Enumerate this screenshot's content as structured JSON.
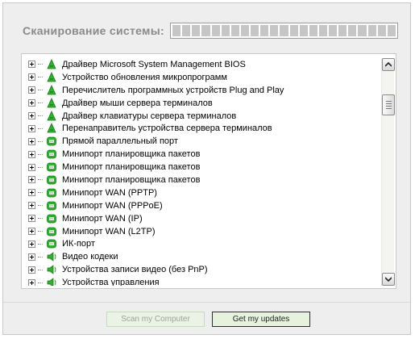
{
  "header": {
    "title": "Сканирование системы:"
  },
  "progress": {
    "segments": 23,
    "filled": 0
  },
  "tree": {
    "rows": [
      {
        "label": "Драйвер Microsoft System Management BIOS",
        "icon": "driver-tree-icon"
      },
      {
        "label": "Устройство обновления микропрограмм",
        "icon": "driver-tree-icon"
      },
      {
        "label": "Перечислитель программных устройств Plug and Play",
        "icon": "driver-tree-icon"
      },
      {
        "label": "Драйвер мыши сервера терминалов",
        "icon": "driver-tree-icon"
      },
      {
        "label": "Драйвер клавиатуры сервера терминалов",
        "icon": "driver-tree-icon"
      },
      {
        "label": "Перенаправитель устройства сервера терминалов",
        "icon": "driver-tree-icon"
      },
      {
        "label": "Прямой параллельный порт",
        "icon": "network-adapter-icon"
      },
      {
        "label": "Минипорт планировщика пакетов",
        "icon": "network-adapter-icon"
      },
      {
        "label": "Минипорт планировщика пакетов",
        "icon": "network-adapter-icon"
      },
      {
        "label": "Минипорт планировщика пакетов",
        "icon": "network-adapter-icon"
      },
      {
        "label": "Минипорт WAN (PPTP)",
        "icon": "network-adapter-icon"
      },
      {
        "label": "Минипорт WAN (PPPoE)",
        "icon": "network-adapter-icon"
      },
      {
        "label": "Минипорт WAN (IP)",
        "icon": "network-adapter-icon"
      },
      {
        "label": "Минипорт WAN (L2TP)",
        "icon": "network-adapter-icon"
      },
      {
        "label": "ИК-порт",
        "icon": "network-adapter-icon"
      },
      {
        "label": "Видео кодеки",
        "icon": "speaker-icon"
      },
      {
        "label": "Устройства записи видео (без PnP)",
        "icon": "speaker-icon"
      },
      {
        "label": "Устройства управления",
        "icon": "speaker-icon"
      }
    ]
  },
  "buttons": {
    "scan_label": "Scan my Computer",
    "updates_label": "Get my updates"
  },
  "colors": {
    "icon_green": "#2fb02f",
    "button_green": "#e6f2dd",
    "title_gray": "#8a8a8a"
  }
}
